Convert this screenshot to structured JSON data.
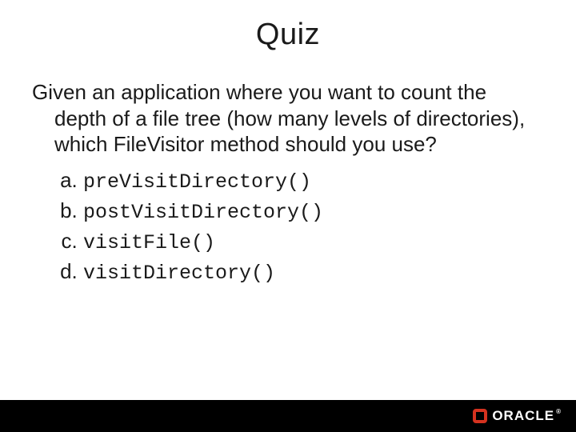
{
  "title": "Quiz",
  "question": "Given an application where you want to count the depth of a file tree (how many levels of directories), which FileVisitor method should you use?",
  "options": {
    "a": "preVisitDirectory()",
    "b": "postVisitDirectory()",
    "c": "visitFile()",
    "d": "visitDirectory()"
  },
  "brand": "ORACLE",
  "reg": "®"
}
